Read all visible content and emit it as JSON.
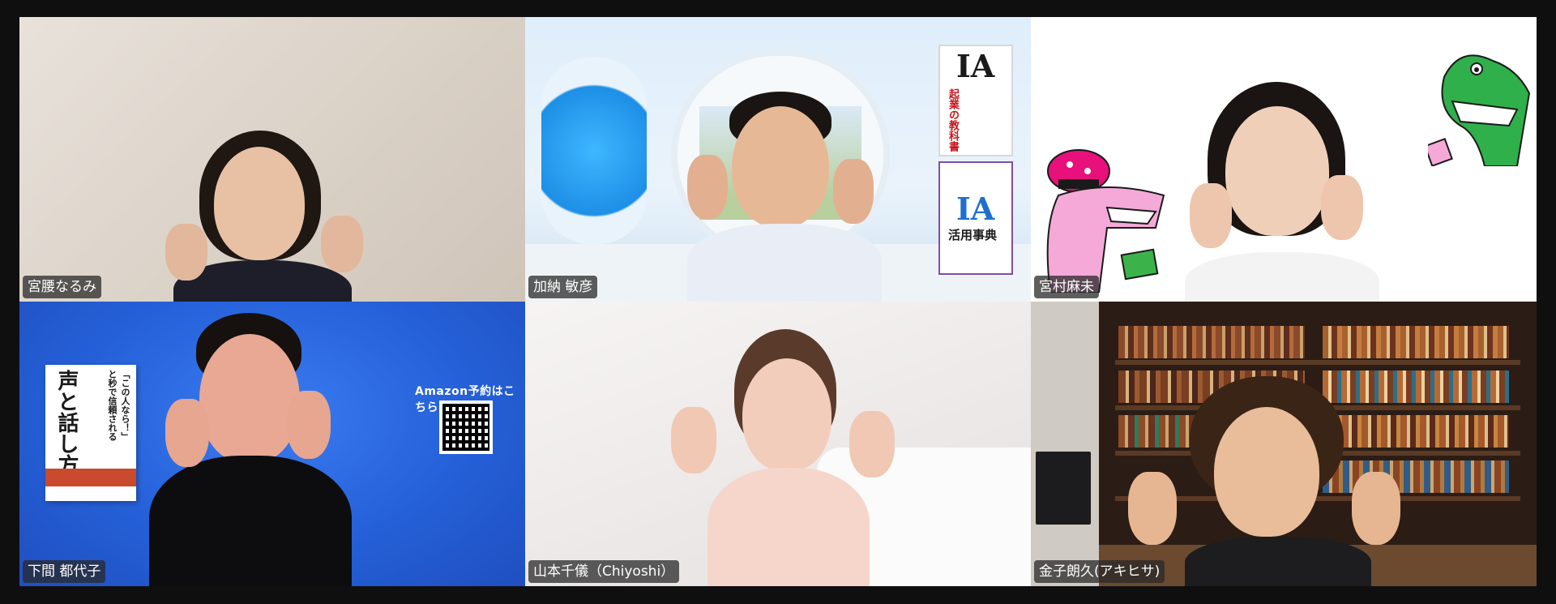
{
  "participants": [
    {
      "name": "宮腰なるみ",
      "active": false
    },
    {
      "name": "加納 敏彦",
      "active": false
    },
    {
      "name": "宮村麻未",
      "active": false
    },
    {
      "name": "下間 都代子",
      "active": false
    },
    {
      "name": "山本千儀（Chiyoshi）",
      "active": false
    },
    {
      "name": "金子朗久(アキヒサ)",
      "active": true
    }
  ],
  "tile2_books": {
    "book_a_title": "IA",
    "book_a_subtitle": "起業の教科書",
    "book_b_title": "IA",
    "book_b_subtitle": "活用事典"
  },
  "tile4_promo": {
    "book_title_main": "声と話し方",
    "book_title_top": "「この人なら！」と秒で信頼される",
    "amazon_text": "Amazon予約はこちら"
  },
  "colors": {
    "active_border": "#23d96b",
    "background": "#0f0f10",
    "name_tag_bg": "rgba(40,40,40,0.75)"
  }
}
